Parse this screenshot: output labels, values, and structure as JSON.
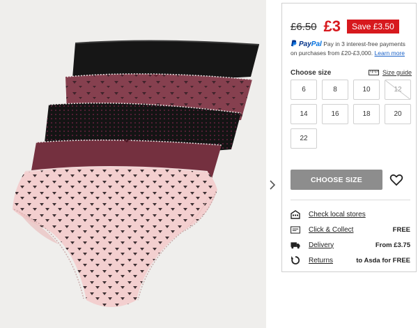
{
  "product_image": {
    "alt_icon": "product-image"
  },
  "navigation": {
    "next_icon": "chevron-right-icon"
  },
  "pricing": {
    "old_price": "£6.50",
    "new_price": "£3",
    "save_badge": "Save £3.50"
  },
  "paypal": {
    "logo_pay": "Pay",
    "logo_pal": "Pal",
    "text": "Pay in 3 interest-free payments on purchases from £20-£3,000.",
    "learn_more": "Learn more"
  },
  "size": {
    "label": "Choose size",
    "guide_label": "Size guide",
    "options": [
      {
        "label": "6",
        "available": true
      },
      {
        "label": "8",
        "available": true
      },
      {
        "label": "10",
        "available": true
      },
      {
        "label": "12",
        "available": false
      },
      {
        "label": "14",
        "available": true
      },
      {
        "label": "16",
        "available": true
      },
      {
        "label": "18",
        "available": true
      },
      {
        "label": "20",
        "available": true
      },
      {
        "label": "22",
        "available": true
      }
    ]
  },
  "actions": {
    "choose_size_button": "CHOOSE SIZE",
    "wishlist_icon": "heart-icon"
  },
  "delivery": {
    "rows": [
      {
        "icon": "store-icon",
        "label": "Check local stores",
        "value": ""
      },
      {
        "icon": "click-collect-icon",
        "label": "Click & Collect",
        "value": "FREE"
      },
      {
        "icon": "truck-icon",
        "label": "Delivery",
        "value": "From £3.75"
      },
      {
        "icon": "return-icon",
        "label": "Returns",
        "value": "to Asda for FREE"
      }
    ]
  },
  "colors": {
    "price_red": "#d7191e",
    "button_grey": "#8d8d8d",
    "link_blue": "#1a62c8",
    "paypal_navy": "#003087",
    "paypal_blue": "#0070e0"
  }
}
